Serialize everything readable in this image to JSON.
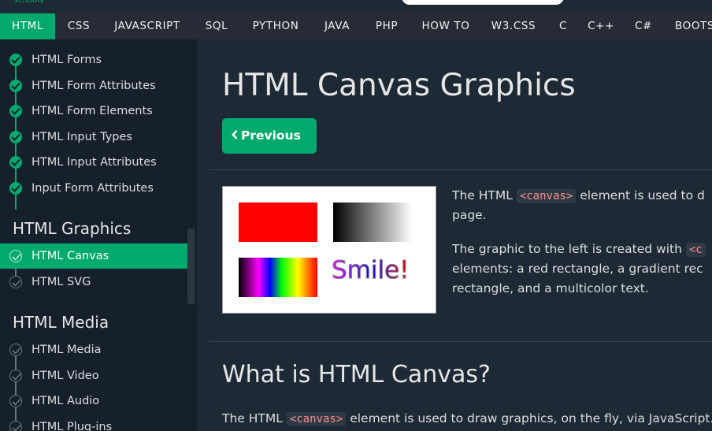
{
  "brand": {
    "small_text": "schools"
  },
  "nav": {
    "items": [
      "HTML",
      "CSS",
      "JAVASCRIPT",
      "SQL",
      "PYTHON",
      "JAVA",
      "PHP",
      "HOW TO",
      "W3.CSS",
      "C",
      "C++",
      "C#",
      "BOOTSTRAP"
    ],
    "active_index": 0
  },
  "sidebar": {
    "forms_items": [
      "HTML Forms",
      "HTML Form Attributes",
      "HTML Form Elements",
      "HTML Input Types",
      "HTML Input Attributes",
      "Input Form Attributes"
    ],
    "graphics_heading": "HTML Graphics",
    "graphics_items": [
      "HTML Canvas",
      "HTML SVG"
    ],
    "media_heading": "HTML Media",
    "media_items": [
      "HTML Media",
      "HTML Video",
      "HTML Audio",
      "HTML Plug-ins"
    ],
    "active_item": "HTML Canvas"
  },
  "main": {
    "title": "HTML Canvas Graphics",
    "prev_label": "Previous",
    "demo": {
      "smile_text": "Smile!"
    },
    "intro": {
      "l1_a": "The HTML ",
      "code": "<canvas>",
      "l1_b": " element is used to d",
      "l2": "page."
    },
    "desc": {
      "l1_a": "The graphic to the left is created with ",
      "l1_code": "<c",
      "l2": "elements: a red rectangle, a gradient rec",
      "l3": "rectangle, and a multicolor text."
    },
    "h2": "What is HTML Canvas?",
    "para": {
      "a": "The HTML ",
      "code": "<canvas>",
      "b": " element is used to draw graphics, on the fly, via JavaScript."
    }
  },
  "colors": {
    "accent": "#04aa6d",
    "nav_bg": "#282a35",
    "sidebar_bg": "#15202b",
    "main_bg": "#1d2a35"
  }
}
